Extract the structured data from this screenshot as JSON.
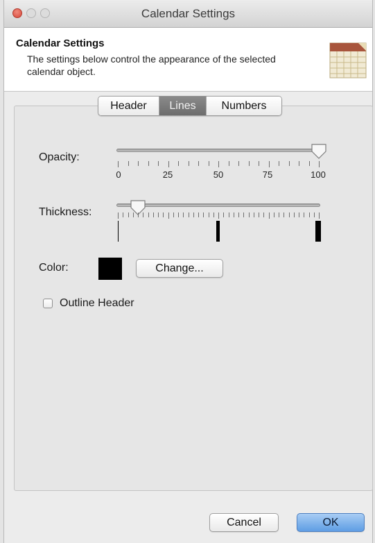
{
  "window": {
    "title": "Calendar Settings"
  },
  "header": {
    "title": "Calendar Settings",
    "description": "The settings below control the appearance of the selected calendar object."
  },
  "tabs": [
    {
      "label": "Header",
      "selected": false
    },
    {
      "label": "Lines",
      "selected": true
    },
    {
      "label": "Numbers",
      "selected": false
    }
  ],
  "opacity": {
    "label": "Opacity:",
    "value": 100,
    "tick_labels": [
      "0",
      "25",
      "50",
      "75",
      "100"
    ]
  },
  "thickness": {
    "label": "Thickness:",
    "value_fraction": 0.1
  },
  "color": {
    "label": "Color:",
    "swatch": "#000000",
    "change_label": "Change..."
  },
  "outline_header": {
    "label": "Outline Header",
    "checked": false
  },
  "footer": {
    "cancel_label": "Cancel",
    "ok_label": "OK"
  },
  "colors": {
    "ok_button": "#5e9de4",
    "selected_tab": "#7b7b7b",
    "close_button": "#d7473a"
  }
}
